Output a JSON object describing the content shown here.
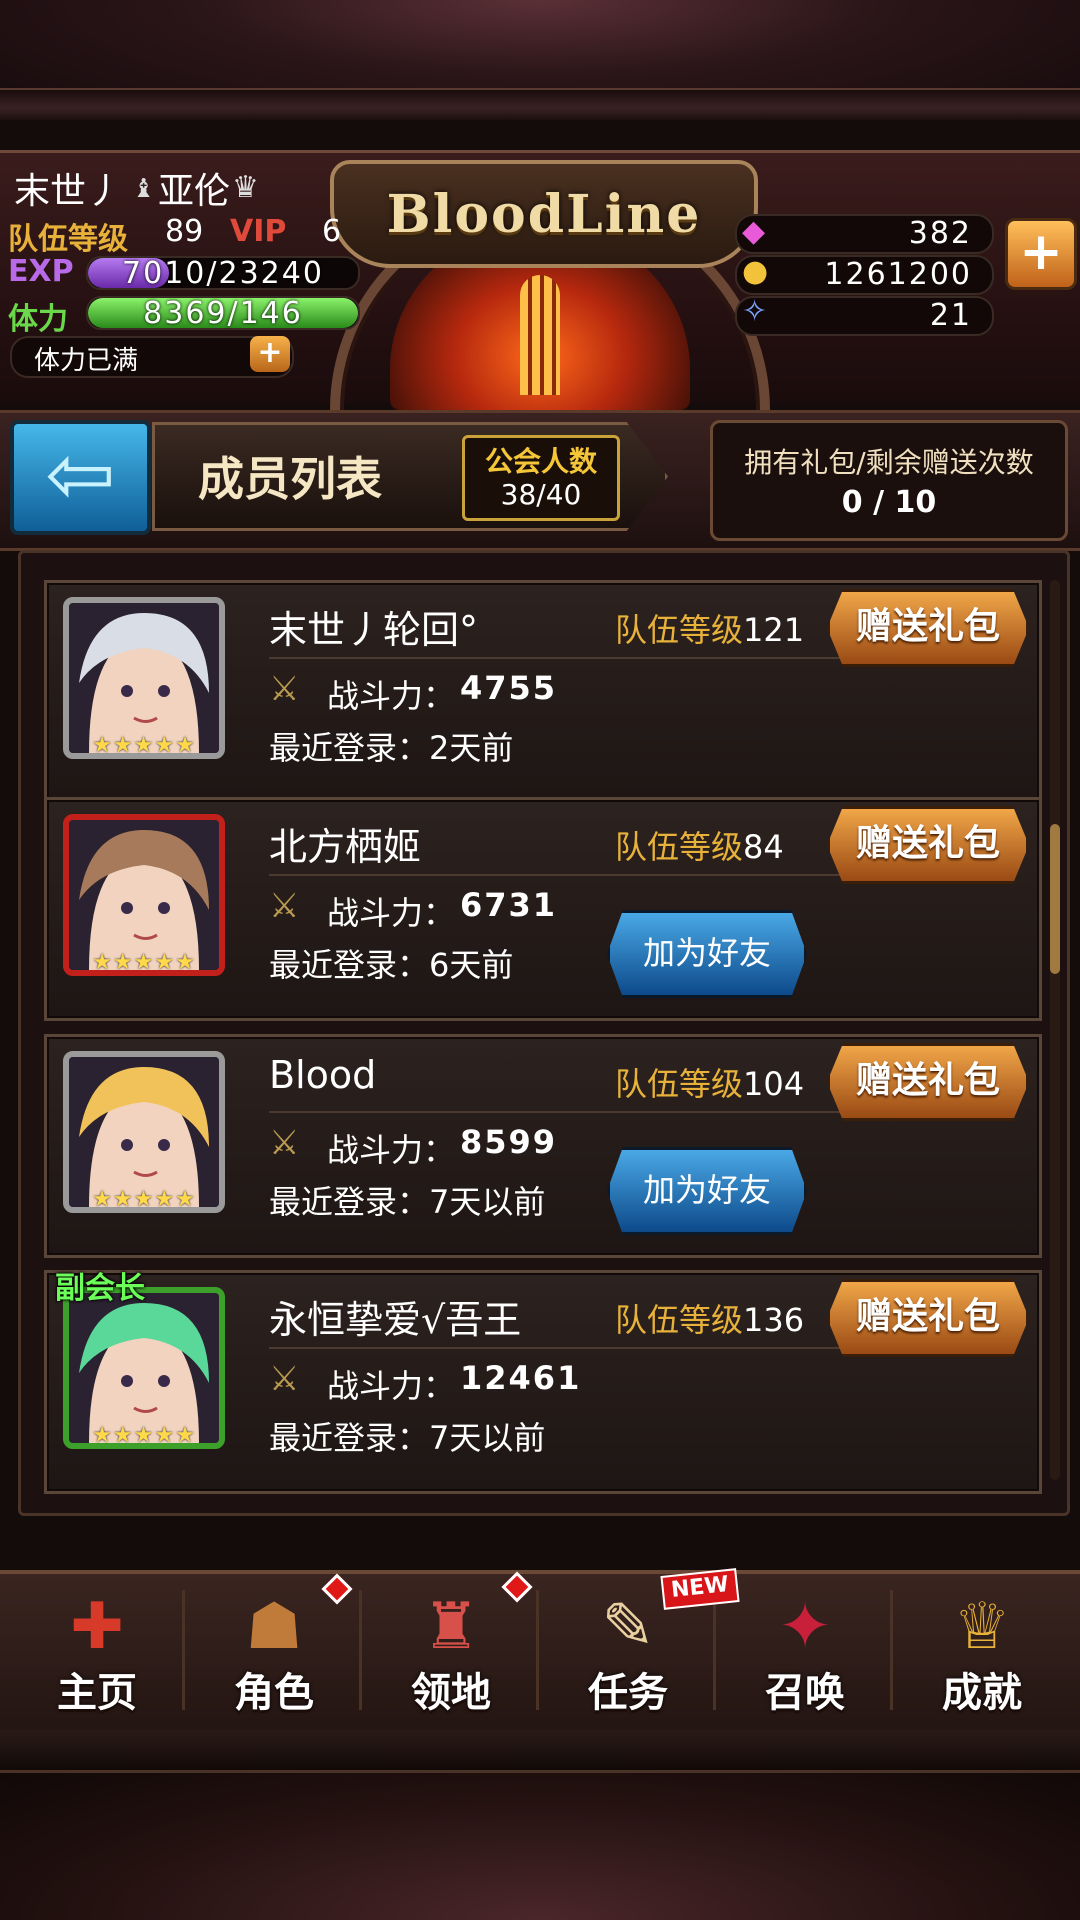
{
  "player": {
    "name_part1": "末世丿",
    "name_part2": "亚伦",
    "team_level_label": "队伍等级",
    "team_level": "89",
    "vip_label": "VIP",
    "vip_level": "6",
    "exp_label": "EXP",
    "exp_text": "7010/23240",
    "exp_fraction": 0.3,
    "stamina_label": "体力",
    "stamina_text": "8369/146",
    "stamina_note": "体力已满"
  },
  "logo": "BloodLine",
  "currencies": {
    "gems": "382",
    "gold": "1261200",
    "crystal": "21",
    "add_label": "+"
  },
  "title_bar": {
    "back_label": "⇦",
    "title": "成员列表",
    "member_count_label": "公会人数",
    "member_count": "38/40",
    "gift_label": "拥有礼包/剩余赠送次数",
    "gift_value": "0 / 10"
  },
  "members": [
    {
      "name": "末世丿轮回°",
      "level_label": "队伍等级",
      "level": "121",
      "power_label": "战斗力：",
      "power": "4755",
      "login": "最近登录：2天前",
      "gift_button": "赠送礼包",
      "friend_button": "",
      "frame_color": "#9a9a9a",
      "hair_color": "#d9dde6",
      "vice_tag": ""
    },
    {
      "name": "北方栖姬",
      "level_label": "队伍等级",
      "level": "84",
      "power_label": "战斗力：",
      "power": "6731",
      "login": "最近登录：6天前",
      "gift_button": "赠送礼包",
      "friend_button": "加为好友",
      "frame_color": "#c2201a",
      "hair_color": "#a67a5a",
      "vice_tag": ""
    },
    {
      "name": "Blood",
      "level_label": "队伍等级",
      "level": "104",
      "power_label": "战斗力：",
      "power": "8599",
      "login": "最近登录：7天以前",
      "gift_button": "赠送礼包",
      "friend_button": "加为好友",
      "frame_color": "#9a9a9a",
      "hair_color": "#f2c25a",
      "vice_tag": ""
    },
    {
      "name": "永恒挚爱√吾王",
      "level_label": "队伍等级",
      "level": "136",
      "power_label": "战斗力：",
      "power": "12461",
      "login": "最近登录：7天以前",
      "gift_button": "赠送礼包",
      "friend_button": "",
      "frame_color": "#3ca02a",
      "hair_color": "#5ad89a",
      "vice_tag": "副会长"
    }
  ],
  "stars": "★★★★★",
  "nav": [
    {
      "label": "主页",
      "icon": "shield-cross-icon",
      "glyph": "✚"
    },
    {
      "label": "角色",
      "icon": "hooded-character-icon",
      "glyph": "☗"
    },
    {
      "label": "领地",
      "icon": "castle-icon",
      "glyph": "♜"
    },
    {
      "label": "任务",
      "icon": "book-quill-icon",
      "glyph": "✎"
    },
    {
      "label": "召唤",
      "icon": "cards-icon",
      "glyph": "✦"
    },
    {
      "label": "成就",
      "icon": "trophy-icon",
      "glyph": "♕"
    }
  ],
  "new_tag": "NEW"
}
